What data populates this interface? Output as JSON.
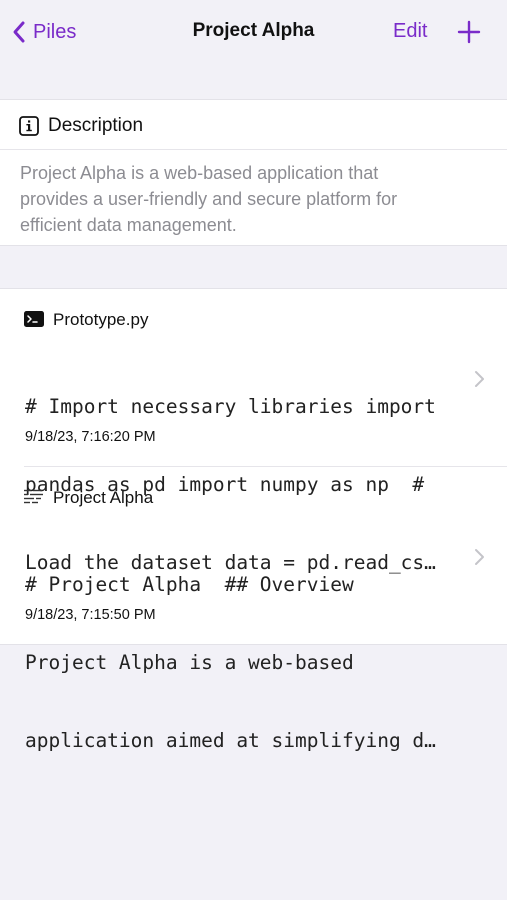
{
  "nav": {
    "back_label": "Piles",
    "title": "Project Alpha",
    "edit_label": "Edit"
  },
  "description": {
    "heading": "Description",
    "text_lines": [
      "Project Alpha is a web-based application that",
      "provides a user-friendly and secure platform for",
      "efficient data management."
    ]
  },
  "items": [
    {
      "icon": "terminal-icon",
      "title": "Prototype.py",
      "body_lines": [
        "# Import necessary libraries import",
        "pandas as pd import numpy as np  #",
        "Load the dataset data = pd.read_cs…"
      ],
      "date": "9/18/23, 7:16:20 PM"
    },
    {
      "icon": "text-lines-icon",
      "title": "Project Alpha",
      "body_lines": [
        "# Project Alpha  ## Overview",
        "Project Alpha is a web-based",
        "application aimed at simplifying d…"
      ],
      "date": "9/18/23, 7:15:50 PM"
    }
  ],
  "colors": {
    "accent": "#7A2BC9",
    "background": "#F2F1F7",
    "card": "#FFFFFF",
    "secondary_text": "#8C8C92"
  }
}
